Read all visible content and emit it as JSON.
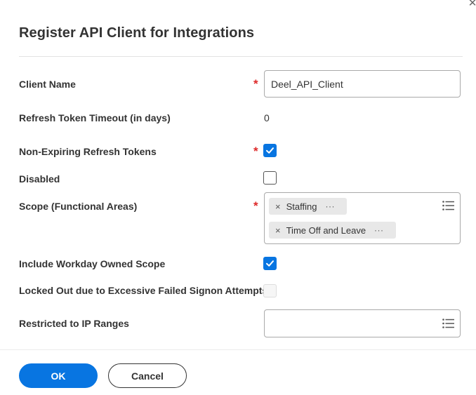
{
  "dialog": {
    "title": "Register API Client for Integrations",
    "close_icon": "close-icon"
  },
  "fields": {
    "client_name": {
      "label": "Client Name",
      "value": "Deel_API_Client",
      "required": "*"
    },
    "refresh_token_timeout": {
      "label": "Refresh Token Timeout (in days)",
      "value": "0"
    },
    "non_expiring_refresh_tokens": {
      "label": "Non-Expiring Refresh Tokens",
      "checked": true,
      "required": "*"
    },
    "disabled": {
      "label": "Disabled",
      "checked": false
    },
    "scope": {
      "label": "Scope (Functional Areas)",
      "required": "*",
      "items": [
        {
          "label": "Staffing"
        },
        {
          "label": "Time Off and Leave"
        }
      ],
      "remove_icon": "×",
      "more_icon": "···"
    },
    "include_workday_owned_scope": {
      "label": "Include Workday Owned Scope",
      "checked": true
    },
    "locked_out": {
      "label": "Locked Out due to Excessive Failed Signon Attempts",
      "checked": false,
      "disabled": true
    },
    "restricted_ip_ranges": {
      "label": "Restricted to IP Ranges",
      "value": ""
    }
  },
  "buttons": {
    "ok": "OK",
    "cancel": "Cancel"
  },
  "colors": {
    "primary": "#0875e1",
    "required": "#de2a2a",
    "pill_bg": "#e8e8e8"
  }
}
